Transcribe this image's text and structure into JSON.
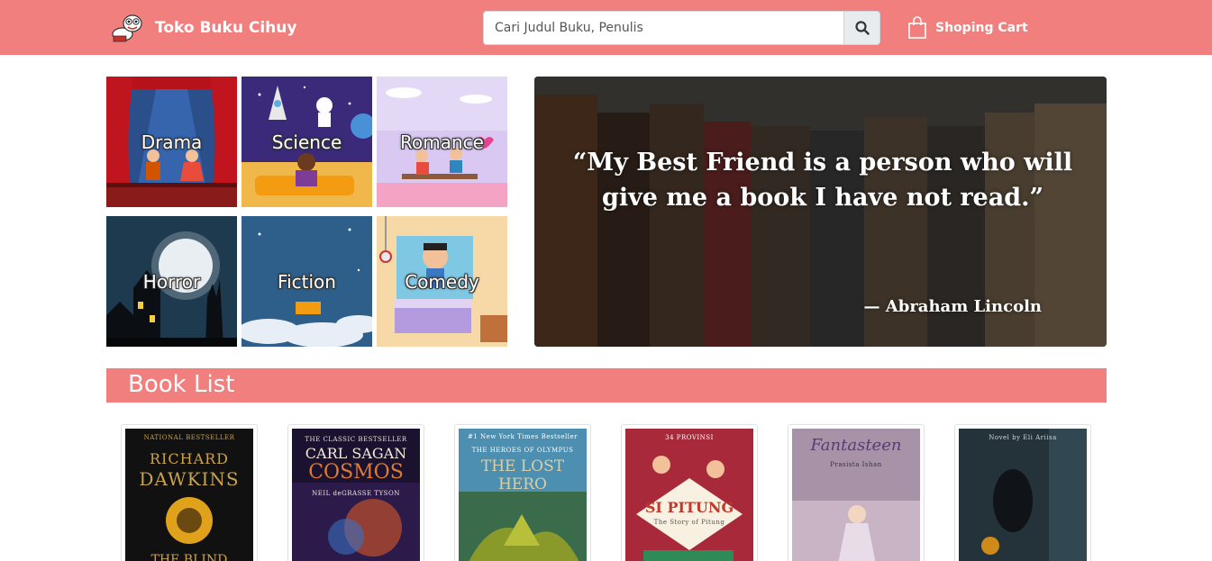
{
  "header": {
    "brand": "Toko Buku Cihuy",
    "search_placeholder": "Cari Judul Buku, Penulis",
    "cart_label": "Shoping Cart"
  },
  "categories": [
    {
      "label": "Drama"
    },
    {
      "label": "Science"
    },
    {
      "label": "Romance"
    },
    {
      "label": "Horror"
    },
    {
      "label": "Fiction"
    },
    {
      "label": "Comedy"
    }
  ],
  "banner": {
    "quote": "“My Best Friend is a person who will give me a book I have not read.”",
    "author": "— Abraham Lincoln"
  },
  "book_list": {
    "title": "Book List",
    "books": [
      {
        "cover_top": "NATIONAL BESTSELLER",
        "line1": "RICHARD",
        "line2": "DAWKINS",
        "line3": "THE BLIND"
      },
      {
        "cover_top": "THE CLASSIC BESTSELLER",
        "line1": "CARL SAGAN",
        "line2": "COSMOS",
        "line3": "NEIL deGRASSE TYSON"
      },
      {
        "cover_top": "#1 New York Times Bestseller",
        "line1": "THE HEROES OF OLYMPUS",
        "line2": "THE LOST HERO",
        "line3": ""
      },
      {
        "cover_top": "34 PROVINSI",
        "line1": "SI PITUNG",
        "line2": "The Story of Pitung",
        "line3": ""
      },
      {
        "cover_top": "",
        "line1": "Fantasteen",
        "line2": "Prasista Ishan",
        "line3": ""
      },
      {
        "cover_top": "Novel by Eli Ariisa",
        "line1": "",
        "line2": "",
        "line3": ""
      }
    ]
  }
}
